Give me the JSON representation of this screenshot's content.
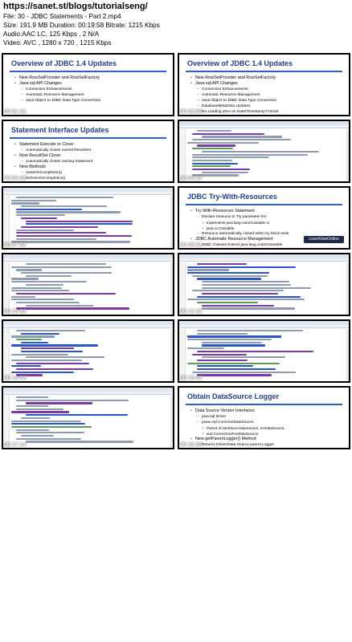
{
  "header": {
    "url": "https://sanet.st/blogs/tutorialseng/",
    "file": "File: 30 - JDBC Statements - Part 2.mp4",
    "size": "Size: 191.9 MB Duration: 00:19:58 Bitrate: 1215 Kbps",
    "audio": "Audio:AAC LC, 125 Kbps , 2 N/A",
    "video": "Video: AVC , 1280 x 720  , 1215 Kbps"
  },
  "thumbnails": [
    {
      "timestamp": "00:01:34",
      "type": "slide",
      "title": "Overview of JDBC 1.4 Updates",
      "bullets": [
        {
          "level": 1,
          "text": "New RowSetProvider and RowSetFactory"
        },
        {
          "level": 1,
          "text": "Java.sql API Changes"
        },
        {
          "level": 2,
          "text": "Connection Enhancements"
        },
        {
          "level": 2,
          "text": "Automatic Resource Management"
        },
        {
          "level": 2,
          "text": "Java Object to JDBC Data Type Conversion"
        }
      ]
    },
    {
      "timestamp": "00:03:08",
      "type": "slide",
      "title": "Overview of JDBC 1.4 Updates",
      "bullets": [
        {
          "level": 1,
          "text": "New RowSetProvider and RowSetFactory"
        },
        {
          "level": 1,
          "text": "Java.sql API Changes"
        },
        {
          "level": 2,
          "text": "Connection Enhancements"
        },
        {
          "level": 2,
          "text": "Automatic Resource Management"
        },
        {
          "level": 2,
          "text": "Java Object to JDBC Data Type Conversion"
        },
        {
          "level": 2,
          "text": "DatabaseMetaData Updates"
        },
        {
          "level": 2,
          "text": "No Leading Zero on Date/Timestamp Format"
        },
        {
          "level": 2,
          "text": "Retrieve Driver or DataSource Parent Logger"
        }
      ]
    },
    {
      "timestamp": "00:04:42",
      "type": "slide",
      "title": "Statement Interface Updates",
      "bullets": [
        {
          "level": 1,
          "text": "Statement Execute or Close:"
        },
        {
          "level": 2,
          "text": "Automatically closes owned ResultSet"
        },
        {
          "level": 1,
          "text": "Now ResultSet Close:"
        },
        {
          "level": 2,
          "text": "Automatically closes owning Statement"
        },
        {
          "level": 1,
          "text": "New Methods"
        },
        {
          "level": 2,
          "text": "closeOnCompletion()"
        },
        {
          "level": 2,
          "text": "isCloseOnCompletion()"
        }
      ]
    },
    {
      "timestamp": "00:06:16",
      "type": "ide"
    },
    {
      "timestamp": "00:07:50",
      "type": "ide"
    },
    {
      "timestamp": "00:09:24",
      "type": "slide",
      "title": "JDBC Try-With-Resources",
      "logo": "LearnNowOnline",
      "bullets": [
        {
          "level": 1,
          "text": "Try-With-Resources Statement"
        },
        {
          "level": 2,
          "text": "Declare resource in Try parameter list"
        },
        {
          "level": 3,
          "text": "Implements java.lang.AutoCloseable or"
        },
        {
          "level": 3,
          "text": "java.io.Closeable"
        },
        {
          "level": 2,
          "text": "Resource automatically closed when try block exits"
        },
        {
          "level": 1,
          "text": "JDBC Automatic Resource Management"
        },
        {
          "level": 2,
          "text": "JDBC Classes Extend java.lang.AutoCloseable"
        },
        {
          "level": 3,
          "text": "Connection, Statement, and ResultSet"
        }
      ]
    },
    {
      "timestamp": "00:10:58",
      "type": "ide"
    },
    {
      "timestamp": "00:12:32",
      "type": "ide"
    },
    {
      "timestamp": "00:14:06",
      "type": "ide"
    },
    {
      "timestamp": "00:15:40",
      "type": "ide"
    },
    {
      "timestamp": "00:17:14",
      "type": "ide"
    },
    {
      "timestamp": "00:18:48",
      "type": "slide",
      "title": "Obtain DataSource Logger",
      "bullets": [
        {
          "level": 1,
          "text": "Data Source Vendor Interfaces"
        },
        {
          "level": 2,
          "text": "java.sql.Driver"
        },
        {
          "level": 2,
          "text": "javax.sql.CommonDataSource"
        },
        {
          "level": 3,
          "text": "Parent of interfaces DataSource, XADataSource,"
        },
        {
          "level": 3,
          "text": "and ConnectionPoolDataSource"
        },
        {
          "level": 1,
          "text": "New getParentLogger() Method"
        },
        {
          "level": 2,
          "text": "Returns Driver/Data Source parent Logger"
        }
      ]
    }
  ]
}
